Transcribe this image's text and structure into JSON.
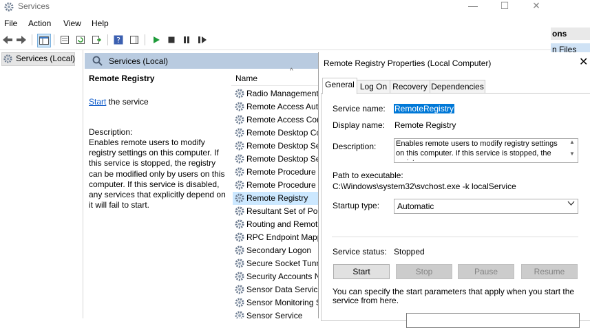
{
  "window": {
    "title": "Services",
    "minimize_glyph": "—",
    "maximize_glyph": "☐",
    "close_glyph": "✕"
  },
  "menu": [
    "File",
    "Action",
    "View",
    "Help"
  ],
  "tree": {
    "item": "Services (Local)"
  },
  "pane": {
    "header": "Services (Local)",
    "selected_name": "Remote Registry",
    "start_link": "Start",
    "start_suffix": " the service",
    "description_label": "Description:",
    "description": "Enables remote users to modify registry settings on this computer. If this service is stopped, the registry can be modified only by users on this computer. If this service is disabled, any services that explicitly depend on it will fail to start."
  },
  "list": {
    "column_name": "Name",
    "sort_glyph": "^",
    "rows": [
      "Radio Management",
      "Remote Access Aut",
      "Remote Access Cor",
      "Remote Desktop Co",
      "Remote Desktop Se",
      "Remote Desktop Se",
      "Remote Procedure (",
      "Remote Procedure (",
      "Remote Registry",
      "Resultant Set of Pol",
      "Routing and Remot",
      "RPC Endpoint Mapp",
      "Secondary Logon",
      "Secure Socket Tunn",
      "Security Accounts N",
      "Sensor Data Service",
      "Sensor Monitoring S",
      "Sensor Service"
    ],
    "selected_index": 8
  },
  "right_strip": {
    "actions_header": "ons",
    "services_files": "n Files"
  },
  "dialog": {
    "title": "Remote Registry Properties (Local Computer)",
    "close_glyph": "✕",
    "tabs": [
      "General",
      "Log On",
      "Recovery",
      "Dependencies"
    ],
    "active_tab": "General",
    "service_name_label": "Service name:",
    "service_name_value": "RemoteRegistry",
    "display_name_label": "Display name:",
    "display_name_value": "Remote Registry",
    "description_label": "Description:",
    "description_value": "Enables remote users to modify registry settings on this computer. If this service is stopped, the registry",
    "path_label": "Path to executable:",
    "path_value": "C:\\Windows\\system32\\svchost.exe -k localService",
    "startup_type_label": "Startup type:",
    "startup_type_value": "Automatic",
    "status_label": "Service status:",
    "status_value": "Stopped",
    "buttons": {
      "start": "Start",
      "stop": "Stop",
      "pause": "Pause",
      "resume": "Resume"
    },
    "params_text": "You can specify the start parameters that apply when you start the service from here."
  },
  "colors": {
    "pane_header": "#b9cbe0",
    "selection": "#cce8ff",
    "accent": "#0078d7",
    "link": "#0a58c9"
  }
}
